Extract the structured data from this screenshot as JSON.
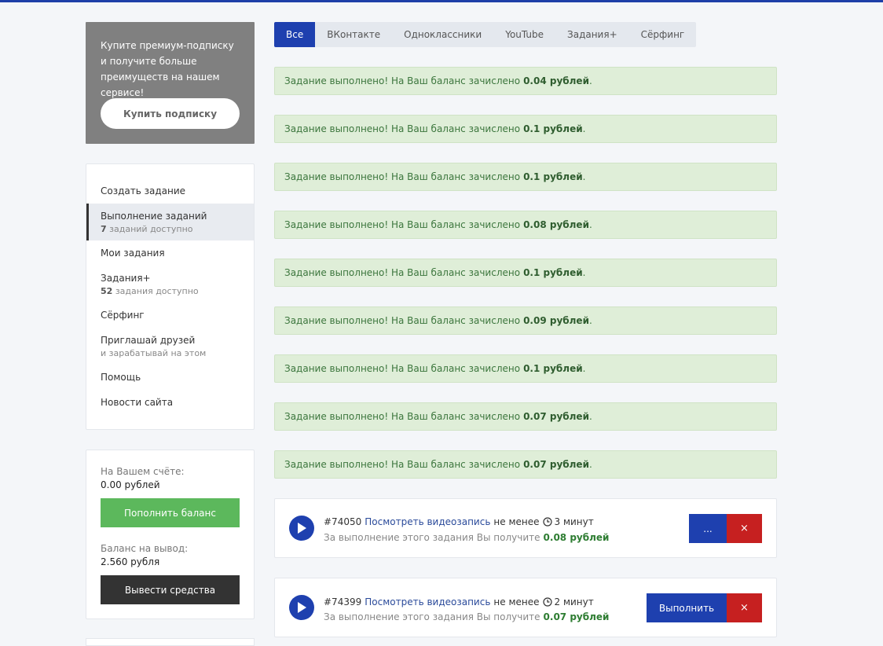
{
  "promo": {
    "text": "Купите премиум-подписку и получите больше преимуществ на нашем сервисе!",
    "button_label": "Купить подписку"
  },
  "menu": {
    "items": [
      {
        "label": "Создать задание",
        "sub": null,
        "active": false
      },
      {
        "label": "Выполнение заданий",
        "sub_count": "7",
        "sub": "заданий доступно",
        "active": true
      },
      {
        "label": "Мои задания",
        "sub": null,
        "active": false
      },
      {
        "label": "Задания+",
        "sub_count": "52",
        "sub": "задания доступно",
        "active": false
      },
      {
        "label": "Сёрфинг",
        "sub": null,
        "active": false
      },
      {
        "label": "Приглашай друзей",
        "sub": "и зарабатывай на этом",
        "active": false
      },
      {
        "label": "Помощь",
        "sub": null,
        "active": false
      },
      {
        "label": "Новости сайта",
        "sub": null,
        "active": false
      }
    ]
  },
  "balance": {
    "account_label": "На Вашем счёте:",
    "account_value": "0.00 рублей",
    "topup_label": "Пополнить баланс",
    "withdraw_balance_label": "Баланс на вывод:",
    "withdraw_balance_value": "2.560 рубля",
    "withdraw_button_label": "Вывести средства"
  },
  "tabs": [
    {
      "label": "Все",
      "active": true
    },
    {
      "label": "ВКонтакте",
      "active": false
    },
    {
      "label": "Одноклассники",
      "active": false
    },
    {
      "label": "YouTube",
      "active": false
    },
    {
      "label": "Задания+",
      "active": false
    },
    {
      "label": "Сёрфинг",
      "active": false
    }
  ],
  "alerts": {
    "text": "Задание выполнено! На Ваш баланс зачислено",
    "amounts": [
      "0.04 рублей",
      "0.1 рублей",
      "0.1 рублей",
      "0.08 рублей",
      "0.1 рублей",
      "0.09 рублей",
      "0.1 рублей",
      "0.07 рублей",
      "0.07 рублей"
    ]
  },
  "tasks": [
    {
      "id": "#74050",
      "link": "Посмотреть видеозапись",
      "min_label": "не менее",
      "duration": "3 минут",
      "reward_label": "За выполнение этого задания Вы получите",
      "reward": "0.08 рублей",
      "primary_label": "...",
      "close_label": "×"
    },
    {
      "id": "#74399",
      "link": "Посмотреть видеозапись",
      "min_label": "не менее",
      "duration": "2 минут",
      "reward_label": "За выполнение этого задания Вы получите",
      "reward": "0.07 рублей",
      "primary_label": "Выполнить",
      "close_label": "×"
    }
  ],
  "colors": {
    "accent": "#1e40af",
    "success_bg": "#dfeed8",
    "success_text": "#3c763d",
    "danger": "#c62020",
    "topup": "#5cb85c",
    "withdraw": "#333333"
  }
}
